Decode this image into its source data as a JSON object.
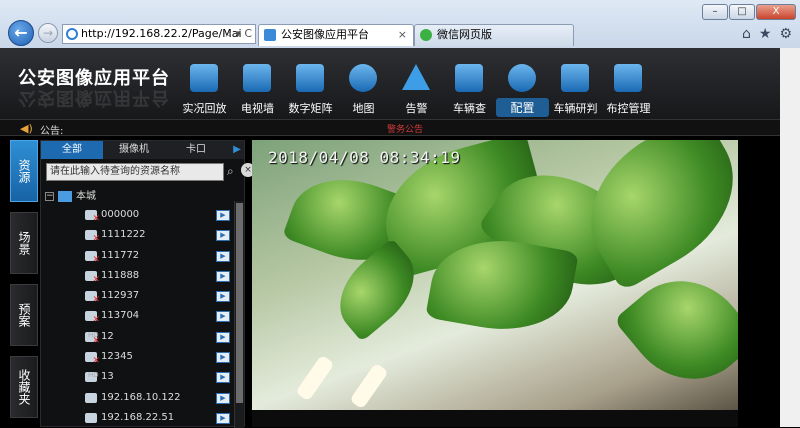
{
  "browser": {
    "address": "http://192.168.22.2/Page/Mai",
    "address_tools": "⌕ ▾ C",
    "tabs": [
      {
        "label": "公安图像应用平台",
        "active": true
      },
      {
        "label": "微信网页版",
        "active": false
      }
    ],
    "window_buttons": {
      "minimize": "–",
      "maximize": "□",
      "close": "X"
    },
    "icons": [
      "home-icon",
      "star-icon",
      "gear-icon"
    ]
  },
  "app": {
    "title": "公安图像应用平台",
    "nav": [
      {
        "label": "实况回放",
        "icon": "grid-icon"
      },
      {
        "label": "电视墙",
        "icon": "tv-wall-icon"
      },
      {
        "label": "数字矩阵",
        "icon": "monitor-icon"
      },
      {
        "label": "地图",
        "icon": "globe-icon"
      },
      {
        "label": "告警",
        "icon": "alert-icon"
      },
      {
        "label": "车辆查",
        "icon": "car-search-icon"
      },
      {
        "label": "配置",
        "icon": "config-star-icon",
        "active": true
      },
      {
        "label": "车辆研判",
        "icon": "car-analysis-icon"
      },
      {
        "label": "布控管理",
        "icon": "car-control-icon"
      }
    ],
    "nav_fragment": "夹"
  },
  "notice": {
    "label": "公告:",
    "message": "警务公告"
  },
  "sidebar": {
    "vtabs": [
      {
        "label": "资源",
        "active": true
      },
      {
        "label": "场景",
        "active": false
      },
      {
        "label": "预案",
        "active": false
      },
      {
        "label": "收藏夹",
        "active": false
      }
    ],
    "panel_tabs": [
      {
        "label": "全部",
        "active": true
      },
      {
        "label": "摄像机",
        "active": false
      },
      {
        "label": "卡口",
        "active": false
      }
    ],
    "search_placeholder": "请在此输入待查询的资源名称",
    "tree_root": "本城",
    "nodes": [
      {
        "name": "000000",
        "offline": true
      },
      {
        "name": "1111222",
        "offline": true
      },
      {
        "name": "111772",
        "offline": true
      },
      {
        "name": "111888",
        "offline": true
      },
      {
        "name": "112937",
        "offline": true
      },
      {
        "name": "113704",
        "offline": true
      },
      {
        "name": "12",
        "offline": true,
        "hd": true
      },
      {
        "name": "12345",
        "offline": true
      },
      {
        "name": "13",
        "offline": false,
        "hd": true
      },
      {
        "name": "192.168.10.122",
        "offline": false
      },
      {
        "name": "192.168.22.51",
        "offline": false
      }
    ],
    "hd_label": "HD"
  },
  "video": {
    "timestamp": "2018/04/08 08:34:19"
  }
}
